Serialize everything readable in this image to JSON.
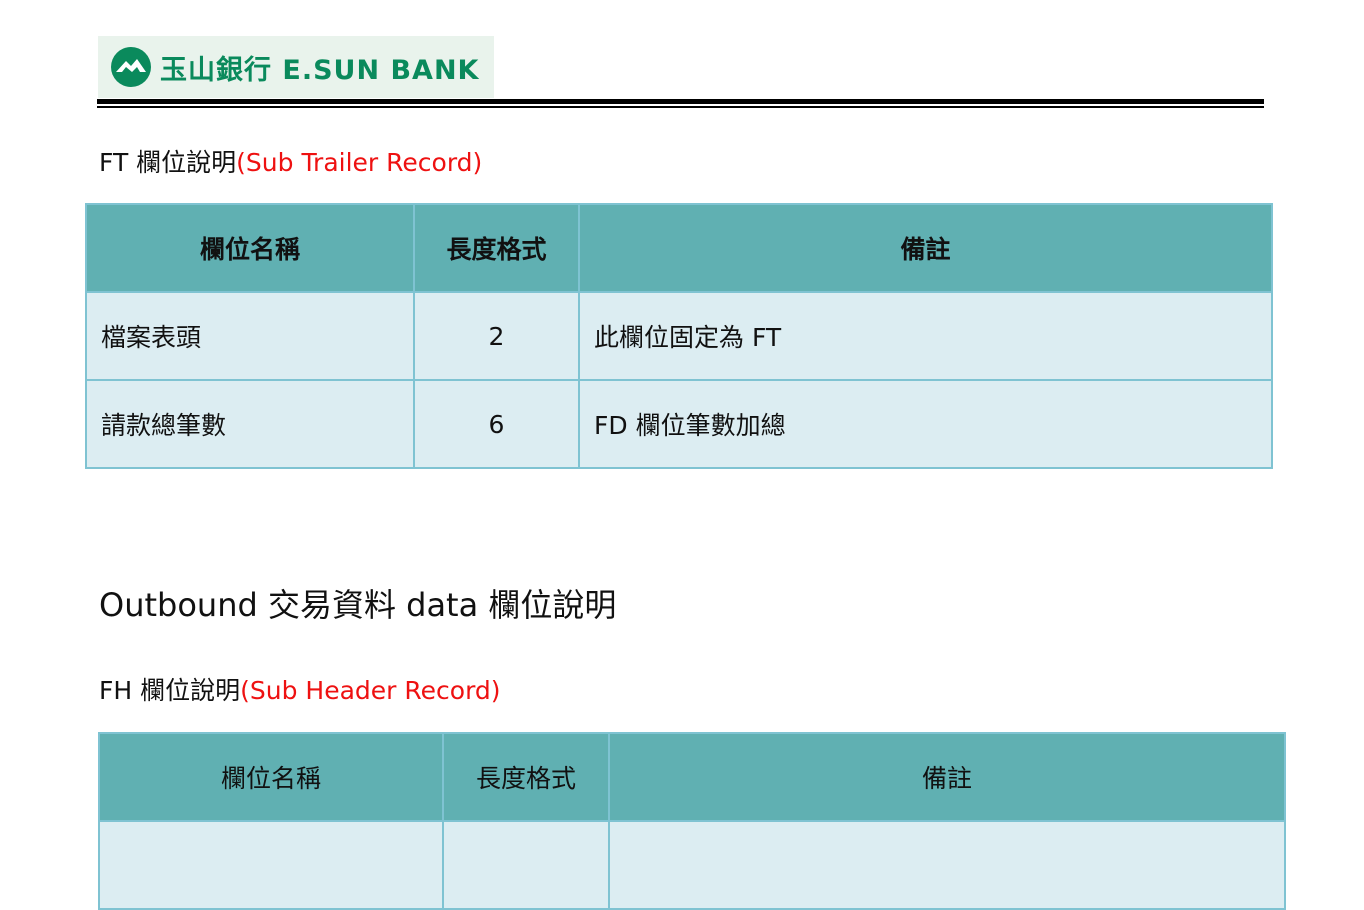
{
  "logo": {
    "text": "玉山銀行 E.SUN BANK",
    "color": "#0a8a5c"
  },
  "ft_section": {
    "title_prefix": "FT 欄位說明",
    "title_suffix": "(Sub Trailer Record)",
    "headers": [
      "欄位名稱",
      "長度格式",
      "備註"
    ],
    "rows": [
      {
        "name": "檔案表頭",
        "length": "2",
        "note": "此欄位固定為 FT"
      },
      {
        "name": "請款總筆數",
        "length": "6",
        "note": "FD 欄位筆數加總"
      }
    ]
  },
  "outbound_heading": "Outbound 交易資料 data 欄位說明",
  "fh_section": {
    "title_prefix": "FH 欄位說明",
    "title_suffix": "(Sub Header Record)",
    "headers": [
      "欄位名稱",
      "長度格式",
      "備註"
    ],
    "rows": [
      {
        "name": "",
        "length": "",
        "note": ""
      }
    ]
  },
  "colors": {
    "header_bg": "#60b0b2",
    "cell_bg": "#dcedf2",
    "border": "#7fc3d2",
    "accent_red": "#ee1111"
  }
}
